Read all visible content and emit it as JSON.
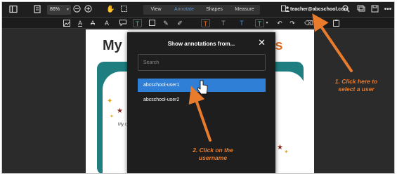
{
  "toolbar": {
    "zoom": "86%",
    "modes": [
      "View",
      "Annotate",
      "Shapes",
      "Measure"
    ],
    "active_mode": "Annotate",
    "user_email": "teacher@abcschool.com"
  },
  "annotate_toolbar": {
    "text_tool_glyph": "T"
  },
  "document": {
    "title_left": "My",
    "title_right": "ons",
    "fragment": "My c"
  },
  "modal": {
    "title": "Show annotations from...",
    "close_glyph": "✕",
    "search_placeholder": "Search",
    "users": [
      {
        "name": "abcschool-user1",
        "selected": true
      },
      {
        "name": "abcschool-user2",
        "selected": false
      }
    ]
  },
  "annotations": {
    "step1_line1": "1. Click here to",
    "step1_line2": "select a user",
    "step2_line1": "2. Click on the",
    "step2_line2": "username",
    "color": "#e87b2c"
  },
  "colors": {
    "accent_blue": "#2f7fd6",
    "tab_active": "#4a90e2",
    "doc_teal": "#1f7f80",
    "title_orange": "#e06b22"
  }
}
